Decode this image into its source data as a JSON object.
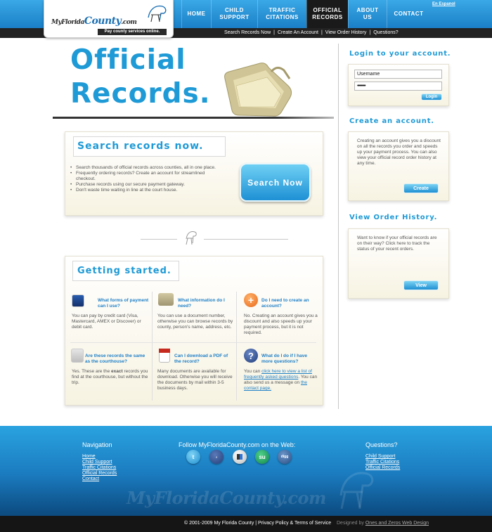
{
  "header": {
    "logo_main": "MyFlorida",
    "logo_county": "County",
    "logo_com": ".com",
    "logo_tagline": "Pay county services online.",
    "espanol": "En Espanol",
    "nav": [
      {
        "l1": "HOME",
        "l2": ""
      },
      {
        "l1": "CHILD",
        "l2": "SUPPORT"
      },
      {
        "l1": "TRAFFIC",
        "l2": "CITATIONS"
      },
      {
        "l1": "OFFICIAL",
        "l2": "RECORDS"
      },
      {
        "l1": "ABOUT",
        "l2": "US"
      },
      {
        "l1": "CONTACT",
        "l2": ""
      }
    ],
    "subnav": [
      "Search Records Now",
      "Create An Account",
      "View Order History",
      "Questions?"
    ],
    "subnav_sep": "|"
  },
  "hero": {
    "line1": "Official",
    "line2": "Records."
  },
  "search": {
    "title": "Search records now.",
    "bullets": [
      "Search thousands of official records across counties, all in one place.",
      "Frequently ordering records? Create an account for streamlined checkout.",
      "Purchase records using our secure payment gateway.",
      "Don't waste time waiting in line at the court house."
    ],
    "button": "Search Now"
  },
  "getting_started": {
    "title": "Getting started.",
    "faqs": [
      {
        "q": "What forms of payment can I use?",
        "a": "You can pay by credit card (Visa, Mastercard, AMEX or Discover) or debit card."
      },
      {
        "q": "What information do I need?",
        "a": "You can use a document number, otherwise you can browse records by county, person's name, address, etc."
      },
      {
        "q": "Do I need to create an account?",
        "a": "No. Creating an account gives you a discount and also speeds up your payment process, but it is not required."
      },
      {
        "q": "Are these records the same as the courthouse?",
        "a_pre": "Yes. These are the ",
        "a_bold": "exact",
        "a_post": " records you find at the courthouse, but without the trip."
      },
      {
        "q": "Can I download a PDF of the record?",
        "a": "Many documents are available for download. Otherwise you will receive the documents by mail within 3-5 business days."
      },
      {
        "q": "What do I do if I have more questions?",
        "a_pre": "You can ",
        "a_link1": "click here to view a list of frequently asked questions",
        "a_mid": ". You can also send us a message on ",
        "a_link2": "the contact page."
      }
    ]
  },
  "sidebar": {
    "login_title": "Login to your account.",
    "username_value": "Username",
    "password_value": "••••••••",
    "login_button": "Login",
    "create_title": "Create an account.",
    "create_text": "Creating an account gives you a discount on all the records you order and speeds up your payment process. You can also view your official record order history at any time.",
    "create_button": "Create",
    "history_title": "View Order History.",
    "history_text": "Want to know if your official records are on their way? Click here to track the status of your recent orders.",
    "history_button": "View"
  },
  "footer": {
    "nav_heading": "Navigation",
    "nav_links": [
      "Home",
      "Child Support",
      "Traffic Citations",
      "Official Records",
      "Contact"
    ],
    "social_heading": "Follow MyFloridaCounty.com on the Web:",
    "questions_heading": "Questions?",
    "question_links": [
      "Child Support",
      "Traffic Citations",
      "Official Records"
    ],
    "watermark": "MyFloridaCounty.com",
    "copyright": "© 2001-2009 My Florida County | Privacy Policy & Terms of Service",
    "designed_by_pre": "Designed by ",
    "designed_by": "Ones and Zeros Web Design"
  },
  "colors": {
    "accent": "#1e9ad6",
    "header_blue": "#2a96d9",
    "dark": "#222222"
  }
}
